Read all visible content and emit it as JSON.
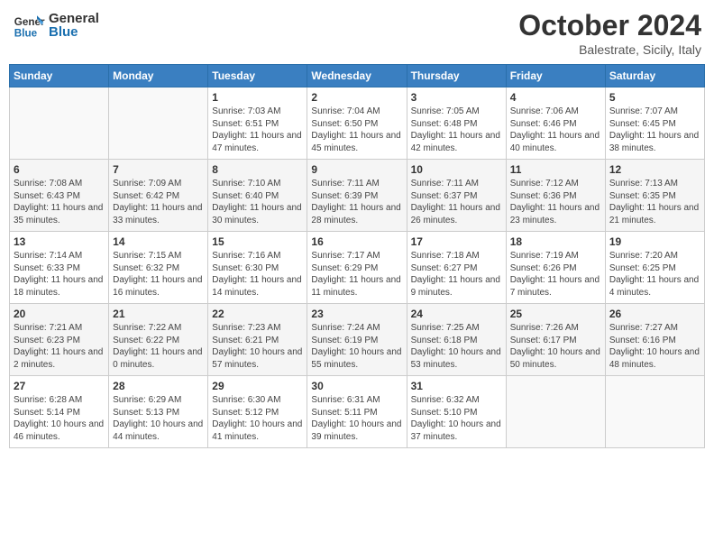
{
  "header": {
    "logo_line1": "General",
    "logo_line2": "Blue",
    "month": "October 2024",
    "location": "Balestrate, Sicily, Italy"
  },
  "weekdays": [
    "Sunday",
    "Monday",
    "Tuesday",
    "Wednesday",
    "Thursday",
    "Friday",
    "Saturday"
  ],
  "weeks": [
    [
      {
        "day": "",
        "info": ""
      },
      {
        "day": "",
        "info": ""
      },
      {
        "day": "1",
        "info": "Sunrise: 7:03 AM\nSunset: 6:51 PM\nDaylight: 11 hours\nand 47 minutes."
      },
      {
        "day": "2",
        "info": "Sunrise: 7:04 AM\nSunset: 6:50 PM\nDaylight: 11 hours\nand 45 minutes."
      },
      {
        "day": "3",
        "info": "Sunrise: 7:05 AM\nSunset: 6:48 PM\nDaylight: 11 hours\nand 42 minutes."
      },
      {
        "day": "4",
        "info": "Sunrise: 7:06 AM\nSunset: 6:46 PM\nDaylight: 11 hours\nand 40 minutes."
      },
      {
        "day": "5",
        "info": "Sunrise: 7:07 AM\nSunset: 6:45 PM\nDaylight: 11 hours\nand 38 minutes."
      }
    ],
    [
      {
        "day": "6",
        "info": "Sunrise: 7:08 AM\nSunset: 6:43 PM\nDaylight: 11 hours\nand 35 minutes."
      },
      {
        "day": "7",
        "info": "Sunrise: 7:09 AM\nSunset: 6:42 PM\nDaylight: 11 hours\nand 33 minutes."
      },
      {
        "day": "8",
        "info": "Sunrise: 7:10 AM\nSunset: 6:40 PM\nDaylight: 11 hours\nand 30 minutes."
      },
      {
        "day": "9",
        "info": "Sunrise: 7:11 AM\nSunset: 6:39 PM\nDaylight: 11 hours\nand 28 minutes."
      },
      {
        "day": "10",
        "info": "Sunrise: 7:11 AM\nSunset: 6:37 PM\nDaylight: 11 hours\nand 26 minutes."
      },
      {
        "day": "11",
        "info": "Sunrise: 7:12 AM\nSunset: 6:36 PM\nDaylight: 11 hours\nand 23 minutes."
      },
      {
        "day": "12",
        "info": "Sunrise: 7:13 AM\nSunset: 6:35 PM\nDaylight: 11 hours\nand 21 minutes."
      }
    ],
    [
      {
        "day": "13",
        "info": "Sunrise: 7:14 AM\nSunset: 6:33 PM\nDaylight: 11 hours\nand 18 minutes."
      },
      {
        "day": "14",
        "info": "Sunrise: 7:15 AM\nSunset: 6:32 PM\nDaylight: 11 hours\nand 16 minutes."
      },
      {
        "day": "15",
        "info": "Sunrise: 7:16 AM\nSunset: 6:30 PM\nDaylight: 11 hours\nand 14 minutes."
      },
      {
        "day": "16",
        "info": "Sunrise: 7:17 AM\nSunset: 6:29 PM\nDaylight: 11 hours\nand 11 minutes."
      },
      {
        "day": "17",
        "info": "Sunrise: 7:18 AM\nSunset: 6:27 PM\nDaylight: 11 hours\nand 9 minutes."
      },
      {
        "day": "18",
        "info": "Sunrise: 7:19 AM\nSunset: 6:26 PM\nDaylight: 11 hours\nand 7 minutes."
      },
      {
        "day": "19",
        "info": "Sunrise: 7:20 AM\nSunset: 6:25 PM\nDaylight: 11 hours\nand 4 minutes."
      }
    ],
    [
      {
        "day": "20",
        "info": "Sunrise: 7:21 AM\nSunset: 6:23 PM\nDaylight: 11 hours\nand 2 minutes."
      },
      {
        "day": "21",
        "info": "Sunrise: 7:22 AM\nSunset: 6:22 PM\nDaylight: 11 hours\nand 0 minutes."
      },
      {
        "day": "22",
        "info": "Sunrise: 7:23 AM\nSunset: 6:21 PM\nDaylight: 10 hours\nand 57 minutes."
      },
      {
        "day": "23",
        "info": "Sunrise: 7:24 AM\nSunset: 6:19 PM\nDaylight: 10 hours\nand 55 minutes."
      },
      {
        "day": "24",
        "info": "Sunrise: 7:25 AM\nSunset: 6:18 PM\nDaylight: 10 hours\nand 53 minutes."
      },
      {
        "day": "25",
        "info": "Sunrise: 7:26 AM\nSunset: 6:17 PM\nDaylight: 10 hours\nand 50 minutes."
      },
      {
        "day": "26",
        "info": "Sunrise: 7:27 AM\nSunset: 6:16 PM\nDaylight: 10 hours\nand 48 minutes."
      }
    ],
    [
      {
        "day": "27",
        "info": "Sunrise: 6:28 AM\nSunset: 5:14 PM\nDaylight: 10 hours\nand 46 minutes."
      },
      {
        "day": "28",
        "info": "Sunrise: 6:29 AM\nSunset: 5:13 PM\nDaylight: 10 hours\nand 44 minutes."
      },
      {
        "day": "29",
        "info": "Sunrise: 6:30 AM\nSunset: 5:12 PM\nDaylight: 10 hours\nand 41 minutes."
      },
      {
        "day": "30",
        "info": "Sunrise: 6:31 AM\nSunset: 5:11 PM\nDaylight: 10 hours\nand 39 minutes."
      },
      {
        "day": "31",
        "info": "Sunrise: 6:32 AM\nSunset: 5:10 PM\nDaylight: 10 hours\nand 37 minutes."
      },
      {
        "day": "",
        "info": ""
      },
      {
        "day": "",
        "info": ""
      }
    ]
  ]
}
